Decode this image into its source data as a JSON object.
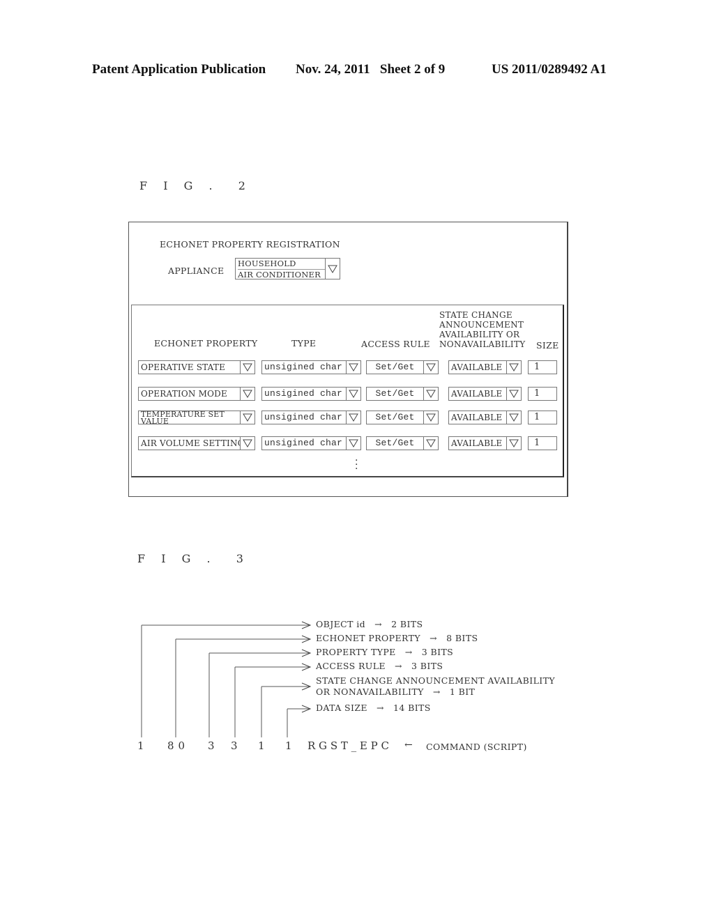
{
  "header": {
    "publication": "Patent Application Publication",
    "date_sheet": "Nov. 24, 2011   Sheet 2 of 9",
    "patent_number": "US 2011/0289492 A1"
  },
  "fig2": {
    "label": "F I G .  2",
    "title": "ECHONET PROPERTY REGISTRATION",
    "appliance_label": "APPLIANCE",
    "appliance_value_line1": "HOUSEHOLD",
    "appliance_value_line2": "AIR CONDITIONER",
    "columns": {
      "property": "ECHONET PROPERTY",
      "type": "TYPE",
      "access": "ACCESS RULE",
      "state_line1": "STATE CHANGE",
      "state_line2": "ANNOUNCEMENT",
      "state_line3": "AVAILABILITY OR",
      "state_line4": "NONAVAILABILITY",
      "size": "SIZE"
    },
    "rows": [
      {
        "property": "OPERATIVE STATE",
        "property_line2": "",
        "type": "unsigined char",
        "access": "Set/Get",
        "state": "AVAILABLE",
        "size": "1"
      },
      {
        "property": "OPERATION MODE",
        "property_line2": "",
        "type": "unsigined char",
        "access": "Set/Get",
        "state": "AVAILABLE",
        "size": "1"
      },
      {
        "property": "TEMPERATURE SET",
        "property_line2": "VALUE",
        "type": "unsigined char",
        "access": "Set/Get",
        "state": "AVAILABLE",
        "size": "1"
      },
      {
        "property": "AIR VOLUME SETTING",
        "property_line2": "",
        "type": "unsigined char",
        "access": "Set/Get",
        "state": "AVAILABLE",
        "size": "1"
      }
    ],
    "continuation": "⋮",
    "dropdown_icon": "triangle-down-outline"
  },
  "fig3": {
    "label": "F I G .  3",
    "fields": [
      {
        "name": "OBJECT id",
        "arrow": "→",
        "bits": "2 BITS"
      },
      {
        "name": "ECHONET PROPERTY",
        "arrow": "→",
        "bits": "8 BITS"
      },
      {
        "name": "PROPERTY TYPE",
        "arrow": "→",
        "bits": "3 BITS"
      },
      {
        "name": "ACCESS RULE",
        "arrow": "→",
        "bits": "3 BITS"
      },
      {
        "name": "STATE CHANGE ANNOUNCEMENT AVAILABILITY",
        "name_line2": "OR NONAVAILABILITY",
        "arrow": "→",
        "bits": "1 BIT"
      },
      {
        "name": "DATA SIZE",
        "arrow": "→",
        "bits": "14 BITS"
      }
    ],
    "command_values": [
      "1",
      "80",
      "3",
      "3",
      "1",
      "1"
    ],
    "command_name": "R G S T _ E P C",
    "command_arrow": "←",
    "command_caption": "COMMAND (SCRIPT)"
  }
}
